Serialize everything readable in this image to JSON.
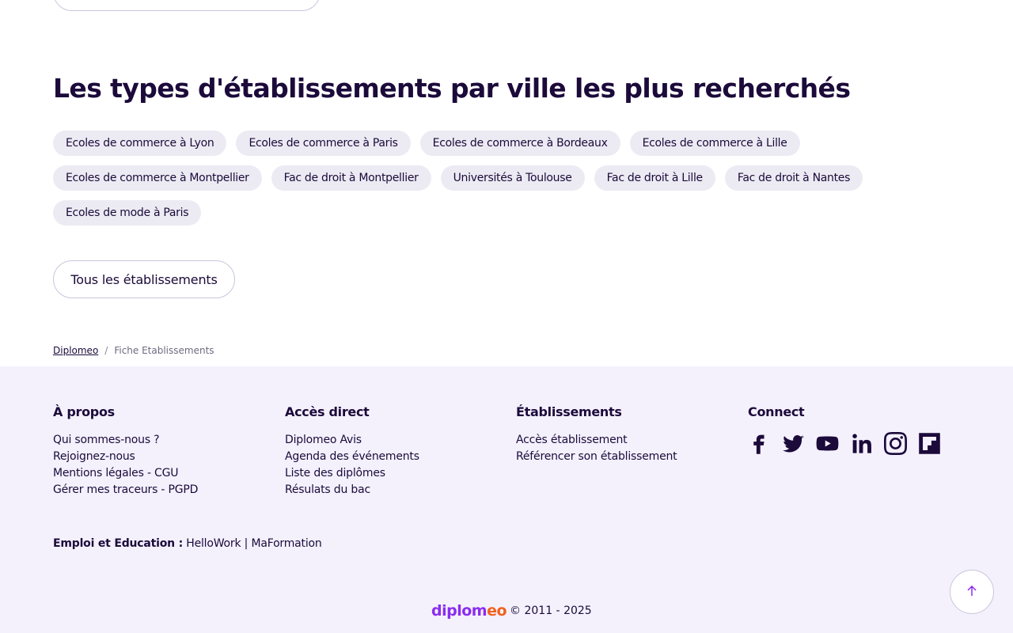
{
  "section": {
    "title": "Les types d'établissements par ville les plus recherchés",
    "chips_row1": [
      "Ecoles de commerce à Lyon",
      "Ecoles de commerce à Paris",
      "Ecoles de commerce à Bordeaux",
      "Ecoles de commerce à Lille"
    ],
    "chips_row2": [
      "Ecoles de commerce à Montpellier",
      "Fac de droit à Montpellier",
      "Universités à Toulouse",
      "Fac de droit à Lille",
      "Fac de droit à Nantes"
    ],
    "chips_row3": [
      "Ecoles de mode à Paris"
    ],
    "all_button": "Tous les établissements"
  },
  "breadcrumb": {
    "home": "Diplomeo",
    "separator": "/",
    "current": "Fiche Etablissements"
  },
  "footer": {
    "about": {
      "title": "À propos",
      "items": [
        "Qui sommes-nous ?",
        "Rejoignez-nous",
        "Mentions légales  -  CGU",
        "Gérer mes traceurs  -  PGPD"
      ]
    },
    "direct": {
      "title": "Accès direct",
      "items": [
        "Diplomeo Avis",
        "Agenda des événements",
        "Liste des diplômes",
        "Résulats du bac"
      ]
    },
    "etablissements": {
      "title": "Établissements",
      "items": [
        "Accès établissement",
        "Référencer son établissement"
      ]
    },
    "connect": {
      "title": "Connect",
      "icons": [
        "facebook-icon",
        "twitter-icon",
        "youtube-icon",
        "linkedin-icon",
        "instagram-icon",
        "flipboard-icon"
      ]
    },
    "emploi": {
      "label": "Emploi et Education :",
      "link1": "HelloWork",
      "separator": "|",
      "link2": "MaFormation"
    },
    "logo_part1": "diplom",
    "logo_part2": "eo",
    "copyright": "© 2011 - 2025"
  },
  "colors": {
    "text": "#1b0a3a",
    "chip_bg": "#ecebf3",
    "footer_bg": "#f4f1fd",
    "brand_purple": "#8b2cf0",
    "brand_orange": "#f0621e"
  }
}
